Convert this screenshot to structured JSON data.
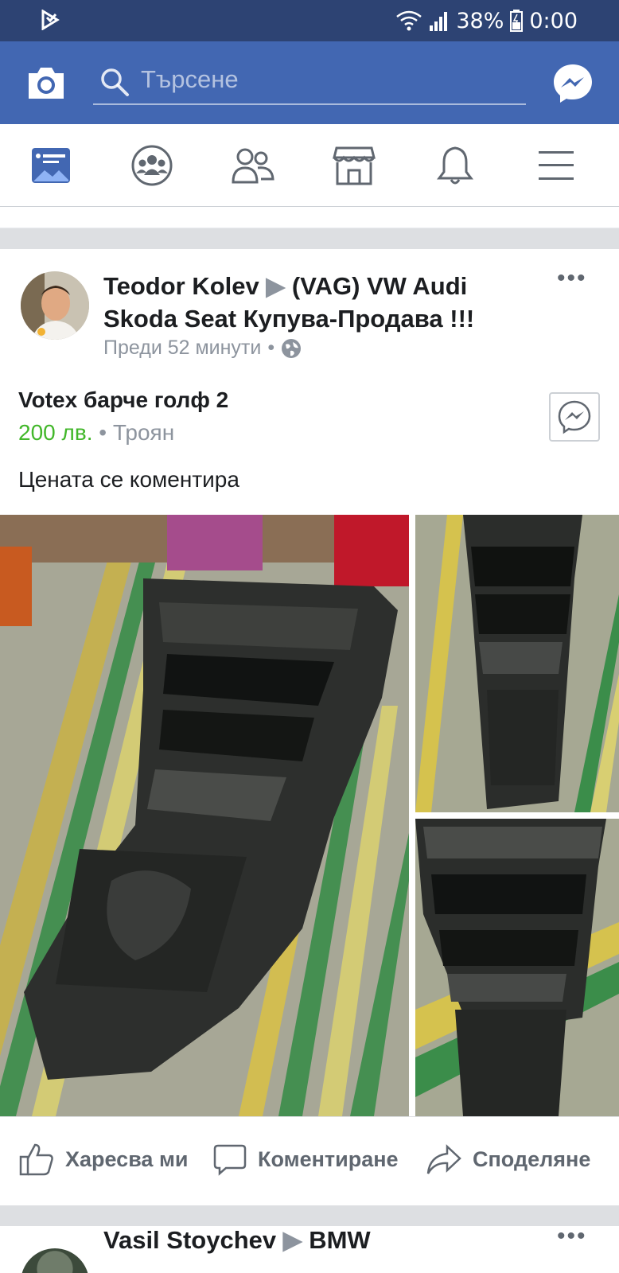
{
  "status_bar": {
    "battery": "38%",
    "time": "0:00"
  },
  "top_bar": {
    "search_placeholder": "Търсене"
  },
  "post": {
    "author": "Teodor Kolev",
    "group": "(VAG) VW Audi Skoda Seat Купува-Продава !!!",
    "time_ago": "Преди 52 минути",
    "item_title": "Votex барче голф 2",
    "price": "200 лв.",
    "location": "Троян",
    "description": "Цената се коментира",
    "actions": {
      "like": "Харесва ми",
      "comment": "Коментиране",
      "share": "Споделяне"
    }
  },
  "next_post": {
    "author": "Vasil Stoychev",
    "group": "BMW"
  }
}
